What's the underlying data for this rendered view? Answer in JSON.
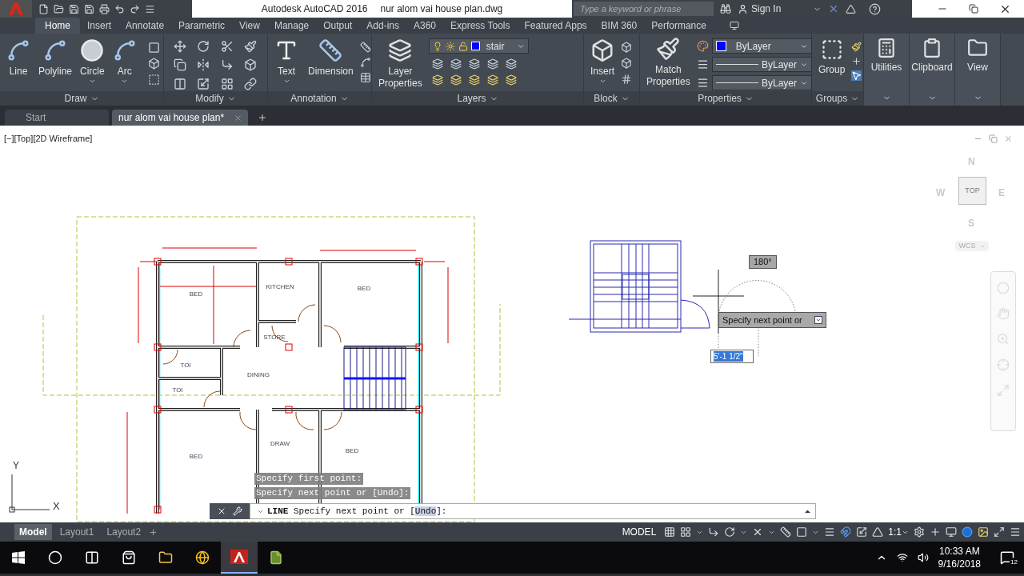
{
  "title_bar": {
    "app_name": "Autodesk AutoCAD 2016",
    "file_name": "nur alom vai house plan.dwg",
    "search": {
      "placeholder": "Type a keyword or phrase"
    },
    "sign_in": "Sign In"
  },
  "ribbon_tabs": [
    {
      "label": "Home",
      "selected": true
    },
    {
      "label": "Insert",
      "selected": false
    },
    {
      "label": "Annotate",
      "selected": false
    },
    {
      "label": "Parametric",
      "selected": false
    },
    {
      "label": "View",
      "selected": false
    },
    {
      "label": "Manage",
      "selected": false
    },
    {
      "label": "Output",
      "selected": false
    },
    {
      "label": "Add-ins",
      "selected": false
    },
    {
      "label": "A360",
      "selected": false
    },
    {
      "label": "Express Tools",
      "selected": false
    },
    {
      "label": "Featured Apps",
      "selected": false
    },
    {
      "label": "BIM 360",
      "selected": false
    },
    {
      "label": "Performance",
      "selected": false
    }
  ],
  "ribbon": {
    "draw": {
      "title": "Draw",
      "tools": [
        "Line",
        "Polyline",
        "Circle",
        "Arc"
      ]
    },
    "modify": {
      "title": "Modify"
    },
    "annotation": {
      "title": "Annotation",
      "tools": [
        "Text",
        "Dimension"
      ]
    },
    "layers": {
      "title": "Layers",
      "tool": "Layer Properties",
      "current_layer": "stair",
      "color": "#0000ff"
    },
    "block": {
      "title": "Block",
      "tool": "Insert"
    },
    "properties": {
      "title": "Properties",
      "tool": "Match Properties",
      "color_value": "ByLayer",
      "color": "#0000ff",
      "linetype": "ByLayer",
      "lineweight": "ByLayer"
    },
    "groups": {
      "title": "Groups",
      "tool": "Group"
    },
    "collapsed": [
      "Utilities",
      "Clipboard",
      "View"
    ]
  },
  "document_tabs": [
    {
      "label": "Start",
      "selected": false
    },
    {
      "label": "nur alom vai house plan*",
      "selected": true
    }
  ],
  "viewport": {
    "label": "[−][Top][2D Wireframe]",
    "rooms": [
      "BED",
      "KITCHEN",
      "BED",
      "STORE",
      "TOI",
      "DINING",
      "TOI",
      "DRAW",
      "BED",
      "BED"
    ],
    "angle": "180°",
    "tooltip": "Specify next point or",
    "distance": "5'-1 1/2\"",
    "viewcube": {
      "north": "N",
      "west": "W",
      "east": "E",
      "south": "S",
      "face": "TOP",
      "ucs": "WCS"
    },
    "ucs_axes": {
      "y": "Y",
      "x": "X"
    }
  },
  "command_line": {
    "history": [
      "Specify first point:",
      "Specify next point or [Undo]:"
    ],
    "command": "LINE",
    "prompt": "Specify next point or [",
    "option": "Undo",
    "end": "]:"
  },
  "layout_tabs": [
    {
      "label": "Model",
      "selected": true
    },
    {
      "label": "Layout1",
      "selected": false
    },
    {
      "label": "Layout2",
      "selected": false
    }
  ],
  "status_bar": {
    "space": "MODEL",
    "scale": "1:1"
  },
  "taskbar": {
    "time": "10:33 AM",
    "date": "9/16/2018",
    "notifications": "12"
  }
}
